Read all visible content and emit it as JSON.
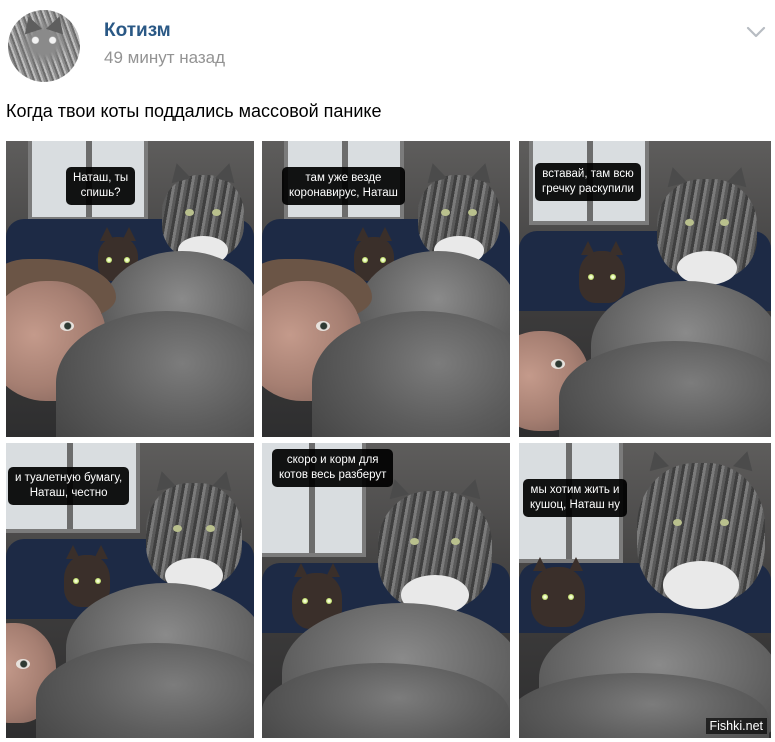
{
  "post": {
    "author": "Котизм",
    "time": "49 минут назад",
    "text": "Когда твои коты поддались массовой панике"
  },
  "photos": [
    {
      "caption": "Наташ, ты\nспишь?"
    },
    {
      "caption": "там уже везде\nкоронавирус, Наташ"
    },
    {
      "caption": "вставай, там всю\nгречку раскупили"
    },
    {
      "caption": "и туалетную бумагу,\nНаташ, честно"
    },
    {
      "caption": "скоро и корм для\nкотов весь разберут"
    },
    {
      "caption": "мы хотим жить и\nкушоц, Наташ ну"
    }
  ],
  "watermark": "Fishki.net",
  "icons": {
    "menu": "chevron-down-icon",
    "avatar": "cat-avatar"
  },
  "colors": {
    "author_link": "#2a5885",
    "time": "#939393"
  }
}
